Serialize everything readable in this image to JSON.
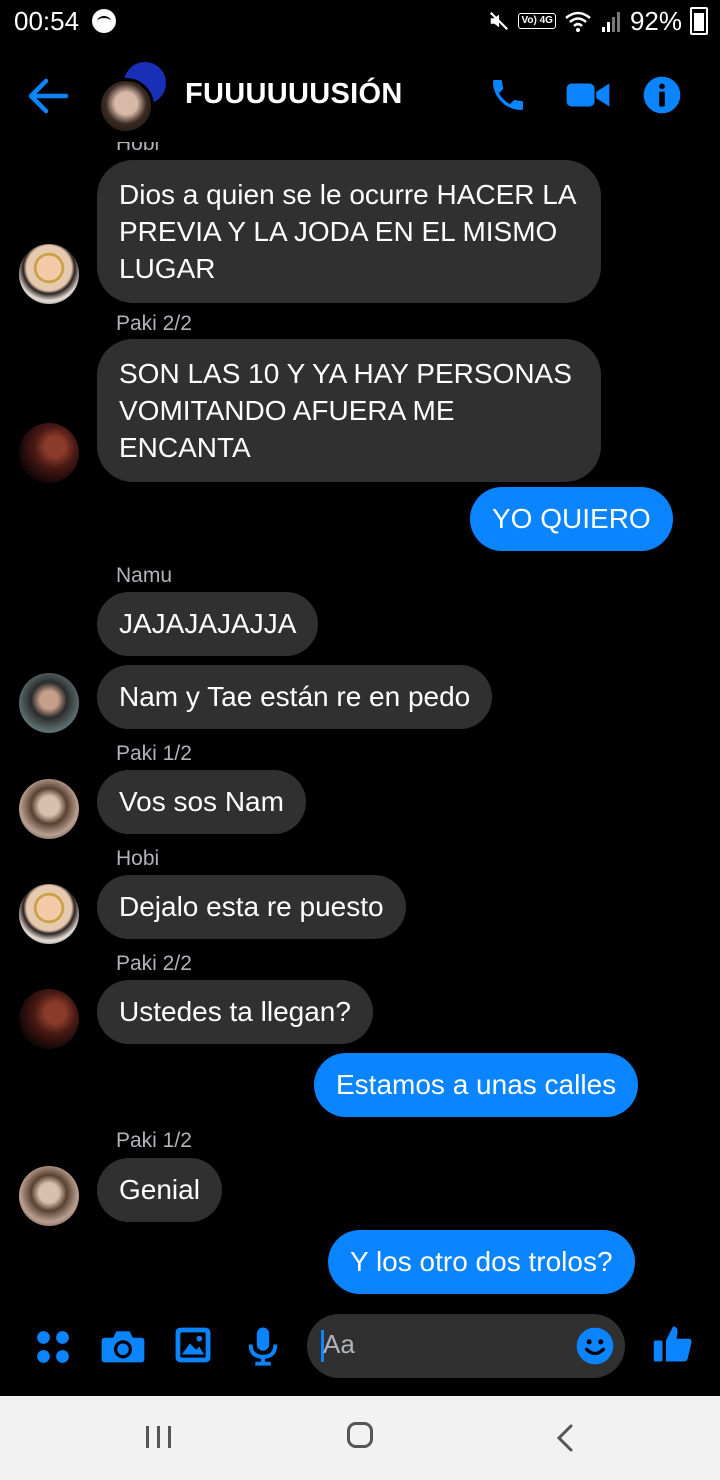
{
  "status_bar": {
    "time": "00:54",
    "volte_label": "Vo) 4G",
    "battery_percent": "92%"
  },
  "header": {
    "title": "FUUUUUUSIÓN"
  },
  "messages": {
    "top_sender_partial": "Hobi",
    "m1": {
      "sender": "Hobi",
      "text": "Dios a quien se le ocurre HACER LA PREVIA Y LA JODA EN EL MISMO LUGAR"
    },
    "m2": {
      "sender": "Paki 2/2",
      "text": "SON LAS 10 Y YA HAY PERSONAS VOMITANDO AFUERA ME ENCANTA"
    },
    "m3": {
      "text": "YO QUIERO"
    },
    "m4": {
      "sender": "Namu",
      "text": "JAJAJAJAJJA"
    },
    "m5": {
      "text": "Nam y Tae están re en pedo"
    },
    "m6": {
      "sender": "Paki 1/2",
      "text": "Vos sos Nam"
    },
    "m7": {
      "sender": "Hobi",
      "text": "Dejalo esta re puesto"
    },
    "m8": {
      "sender": "Paki 2/2",
      "text": "Ustedes ta llegan?"
    },
    "m9": {
      "text": "Estamos a unas calles"
    },
    "m10": {
      "sender": "Paki 1/2",
      "text": "Genial"
    },
    "m11": {
      "text": "Y los otro dos trolos?"
    }
  },
  "composer": {
    "placeholder": "Aa"
  },
  "colors": {
    "accent": "#0a84ff",
    "incoming_bubble": "#303030",
    "background": "#000000"
  }
}
